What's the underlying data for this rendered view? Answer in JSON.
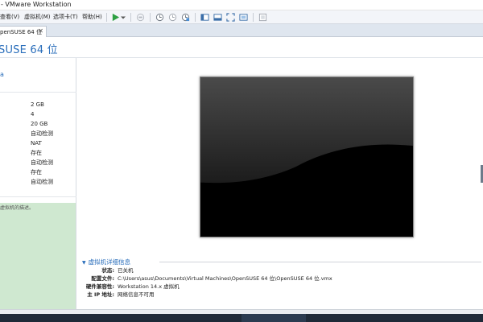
{
  "window": {
    "title": "- VMware Workstation"
  },
  "menu": [
    {
      "label": "查看(V)"
    },
    {
      "label": "虚拟机(M)"
    },
    {
      "label": "选项卡(T)"
    },
    {
      "label": "帮助(H)"
    }
  ],
  "toolbar": {
    "icons": [
      "play-icon",
      "dropdown-arrow-icon",
      "send-keys-icon",
      "snapshot-icon",
      "snapshot-restore-icon",
      "snapshot-manager-icon",
      "show-library-icon",
      "thumbnail-view-icon",
      "full-screen-icon",
      "unity-icon",
      "settings-icon"
    ]
  },
  "tab": {
    "label": "penSUSE 64 位",
    "close": "✕"
  },
  "header": {
    "vm_title": "SUSE 64 位"
  },
  "left": {
    "link": "a",
    "devices": [
      "2 GB",
      "4",
      "20 GB",
      "NAT",
      "存在",
      "自动检测",
      "存在",
      "自动检测"
    ],
    "auto_detect_top": "自动检测",
    "notes_text": "虚拟机的描述。"
  },
  "details": {
    "header": "虚拟机详细信息",
    "rows": [
      {
        "label": "状态:",
        "value": "已关机"
      },
      {
        "label": "配置文件:",
        "value": "C:\\Users\\asus\\Documents\\Virtual Machines\\OpenSUSE 64 位\\OpenSUSE 64 位.vmx"
      },
      {
        "label": "硬件兼容性:",
        "value": "Workstation 14.x 虚拟机"
      },
      {
        "label": "主 IP 地址:",
        "value": "网络信息不可用"
      }
    ]
  },
  "colors": {
    "accent": "#2a6ebb",
    "notes_bg": "#cfe8d0",
    "toolbar_bg": "#f3f5f9"
  }
}
